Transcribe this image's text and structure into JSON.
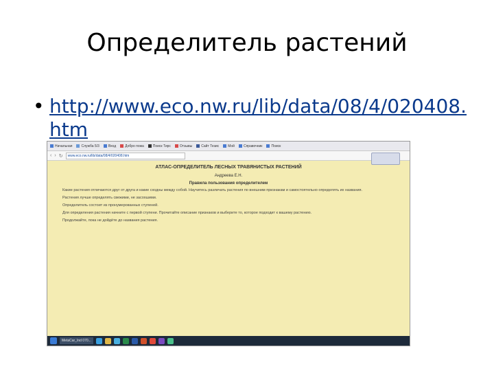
{
  "slide": {
    "title": "Определитель растений",
    "bullet": "•",
    "link": "http://www.eco.nw.ru/lib/data/08/4/020408.htm"
  },
  "browser": {
    "bookmarks": [
      {
        "label": "Начальная",
        "color": "#4a7bd1"
      },
      {
        "label": "Служба 5/3",
        "color": "#6b9ad8"
      },
      {
        "label": "Вход",
        "color": "#4a7bd1"
      },
      {
        "label": "Добро пожа",
        "color": "#d84a4a"
      },
      {
        "label": "Поиск Тирс",
        "color": "#333333"
      },
      {
        "label": "Отзывы",
        "color": "#d84a4a"
      },
      {
        "label": "Сайт Тезис",
        "color": "#3b5998"
      },
      {
        "label": "Мой",
        "color": "#4a7bd1"
      },
      {
        "label": "Справочник",
        "color": "#4a7bd1"
      },
      {
        "label": "Поиск",
        "color": "#4a7bd1"
      }
    ],
    "address": "www.eco.nw.ru/lib/data/08/4/020408.htm",
    "zoom_popup": "",
    "nav_back": "‹",
    "nav_fwd": "›",
    "nav_reload": "↻"
  },
  "page": {
    "title": "АТЛАС-ОПРЕДЕЛИТЕЛЬ ЛЕСНЫХ ТРАВЯНИСТЫХ РАСТЕНИЙ",
    "author": "Андреева Е.Н.",
    "rules_heading": "Правила пользования определителем",
    "paragraphs": [
      "Какие растения отличаются друг от друга и какие сходны между собой. Научитесь различать растения по внешним признакам и самостоятельно определять их названия.",
      "Растения лучше определять свежими, не засохшими.",
      "Определитель состоит из пронумерованных ступеней.",
      "Для определения растения начните с первой ступени. Прочитайте описание признаков и выберите то, которое подходит к вашему растению.",
      "Продолжайте, пока не дойдёте до названия растения."
    ]
  },
  "taskbar": {
    "apps": [
      "MetaCar_Ind 070..."
    ],
    "icons": [
      {
        "name": "ie-icon",
        "color": "#3aa0e0"
      },
      {
        "name": "explorer-icon",
        "color": "#e0b84a"
      },
      {
        "name": "store-icon",
        "color": "#4ab0e0"
      },
      {
        "name": "excel-icon",
        "color": "#2a8a4a"
      },
      {
        "name": "word-icon",
        "color": "#2a5aa8"
      },
      {
        "name": "powerpoint-icon",
        "color": "#d0502a"
      },
      {
        "name": "chrome-icon",
        "color": "#e04a3a"
      },
      {
        "name": "app-icon",
        "color": "#7a4ac0"
      },
      {
        "name": "app2-icon",
        "color": "#4ac08a"
      }
    ],
    "tray_time": "",
    "tray_date": ""
  }
}
